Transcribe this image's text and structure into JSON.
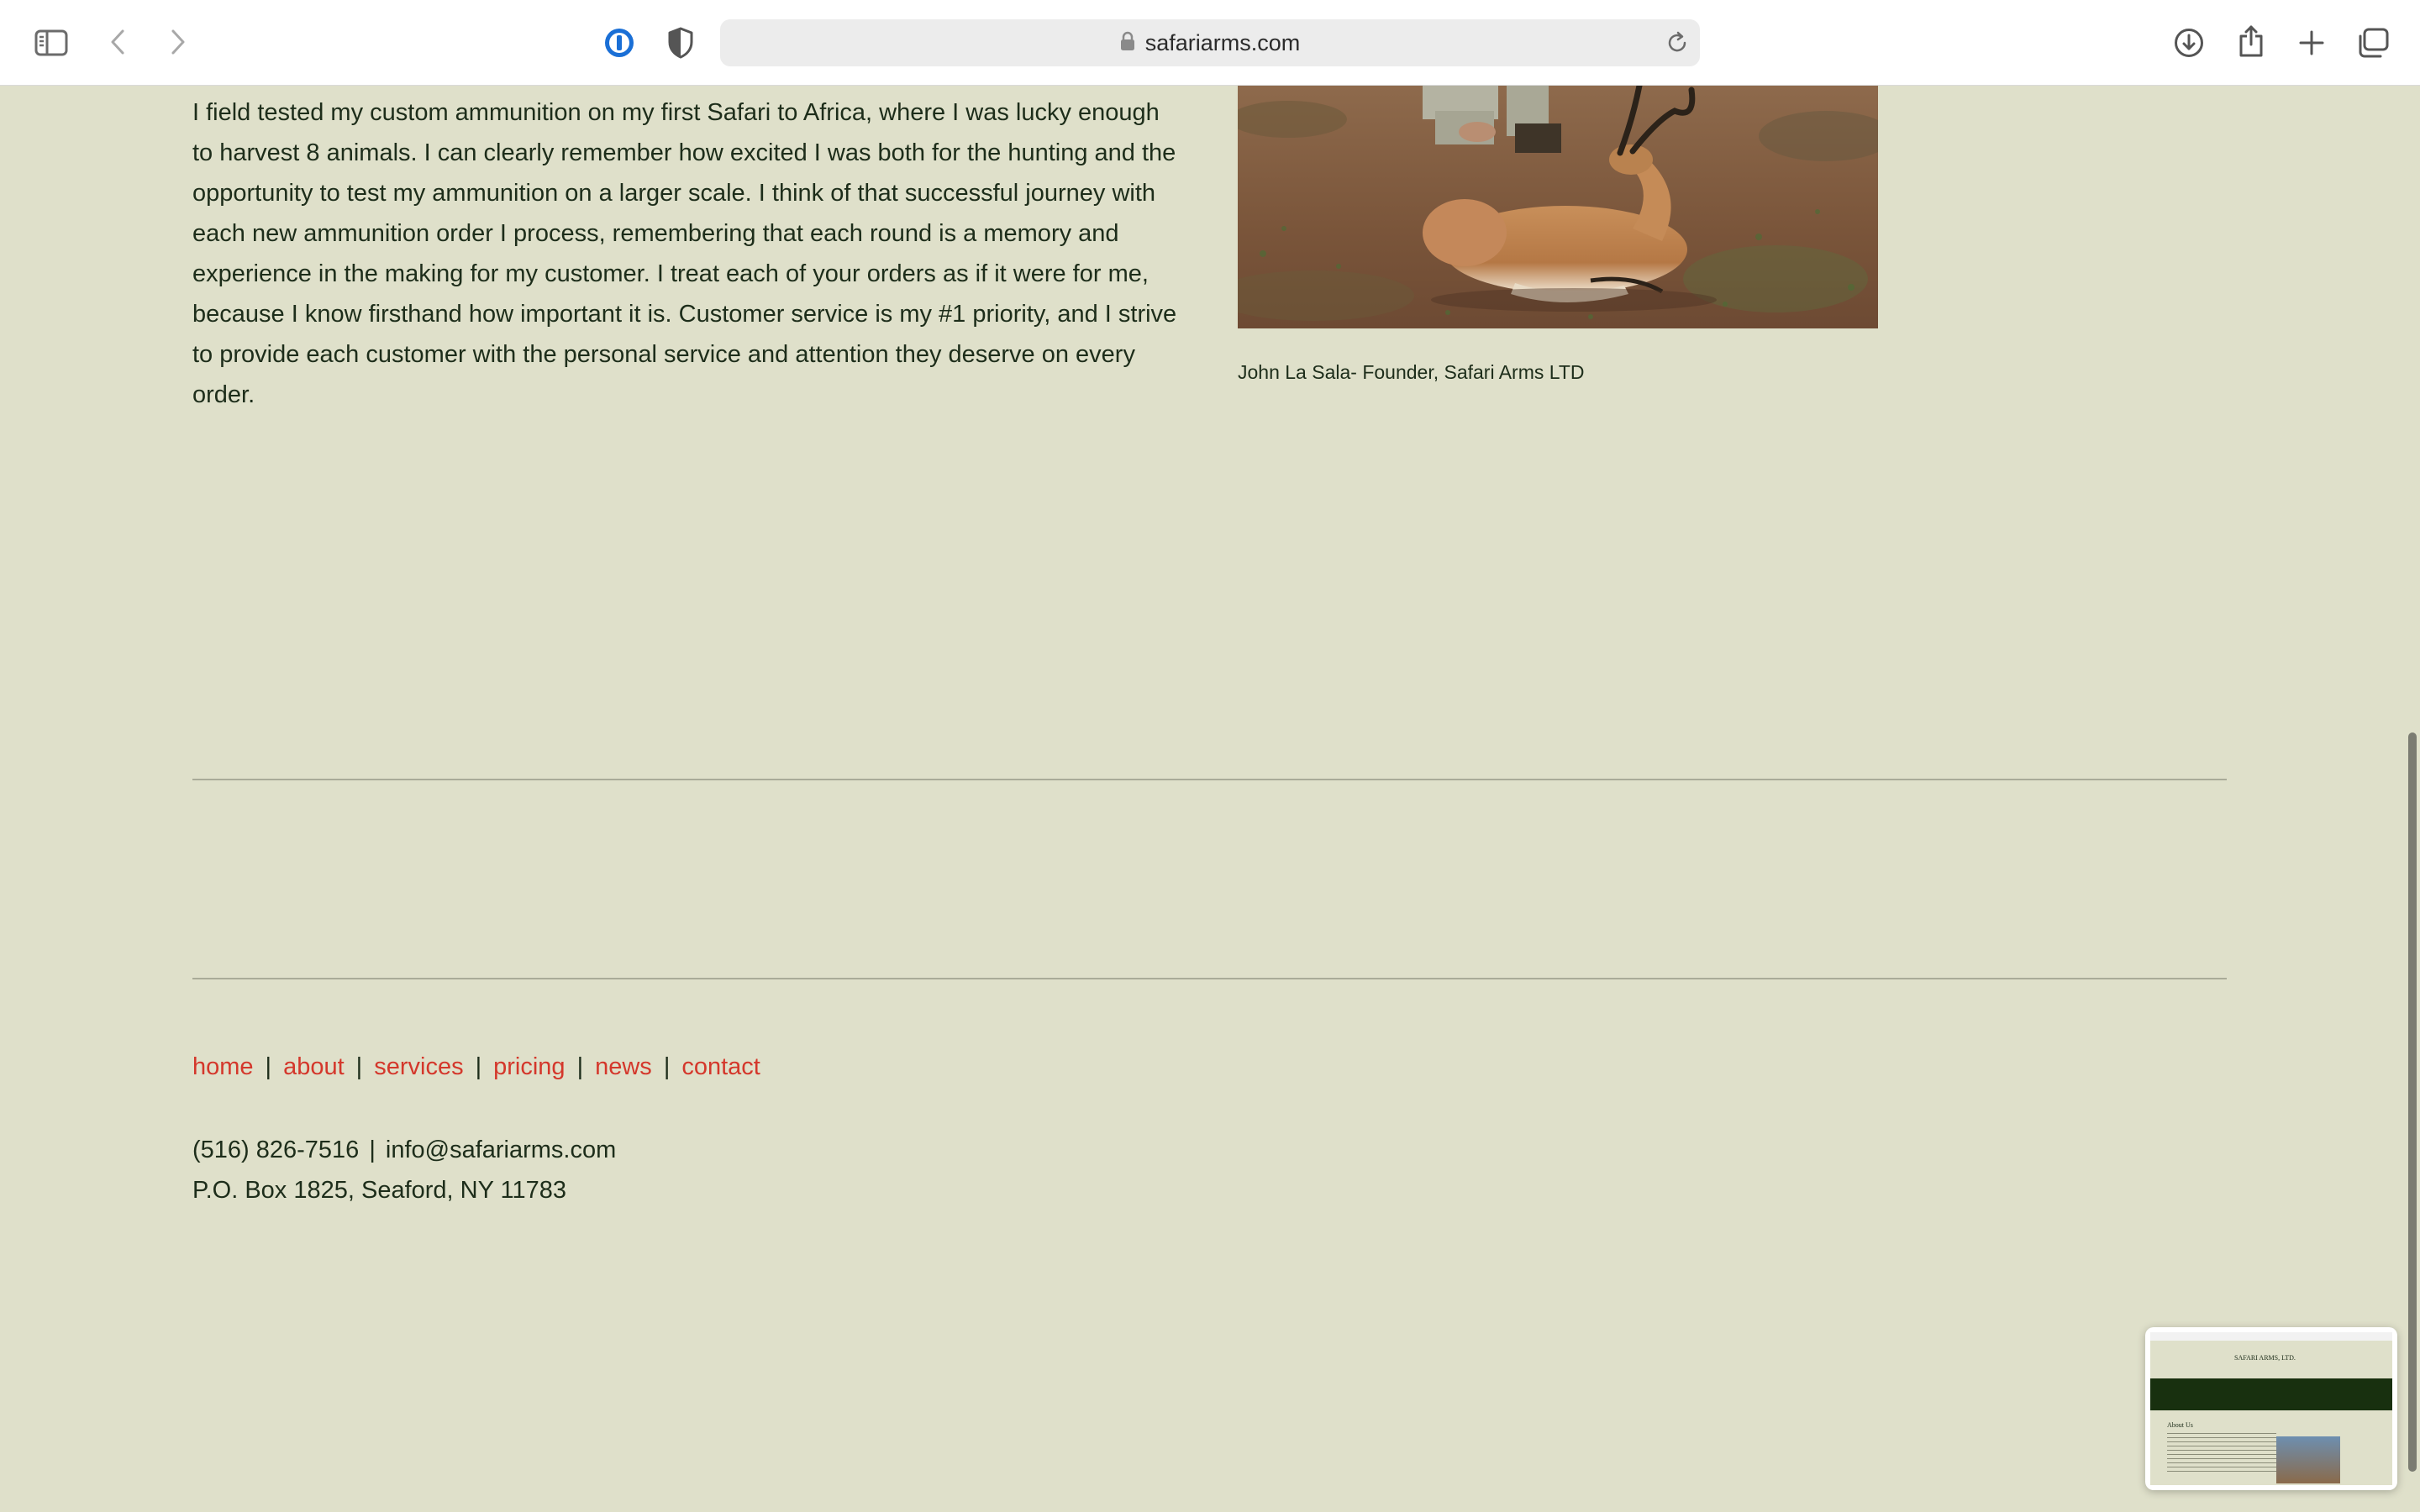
{
  "browser": {
    "url": "safariarms.com",
    "icons": {
      "sidebar": "sidebar-icon",
      "back": "chevron-left-icon",
      "forward": "chevron-right-icon",
      "password_manager": "password-manager-icon",
      "privacy_shield": "shield-icon",
      "lock": "lock-icon",
      "reload": "reload-icon",
      "downloads": "download-icon",
      "share": "share-icon",
      "new_tab": "plus-icon",
      "tab_overview": "tabs-overview-icon"
    }
  },
  "content": {
    "story": "I field tested my custom ammunition on my first Safari to Africa, where I was lucky enough to harvest 8 animals. I can clearly remember how excited I was both for the hunting and the opportunity to test my ammunition on a larger scale. I think of that successful journey with each new ammunition order I process, remembering that each round is a memory and experience in the making for my customer. I treat each of your orders as if it were for me, because I know firsthand how important it is. Customer service is my #1 priority, and I strive to provide each customer with the personal service and attention they deserve on every order.",
    "photo_caption": "John La Sala- Founder, Safari Arms LTD"
  },
  "footer": {
    "nav": [
      "home",
      "about",
      "services",
      "pricing",
      "news",
      "contact"
    ],
    "separator": "|",
    "phone": "(516) 826-7516",
    "email": "info@safariarms.com",
    "address": "P.O. Box 1825, Seaford, NY 11783"
  },
  "preview": {
    "site_title": "SAFARI ARMS, LTD.",
    "heading": "About Us"
  },
  "colors": {
    "page_background": "#dfe0ca",
    "text": "#1d2d1a",
    "link": "#d4372b",
    "divider": "#a9ab98",
    "preview_band": "#18300f"
  }
}
